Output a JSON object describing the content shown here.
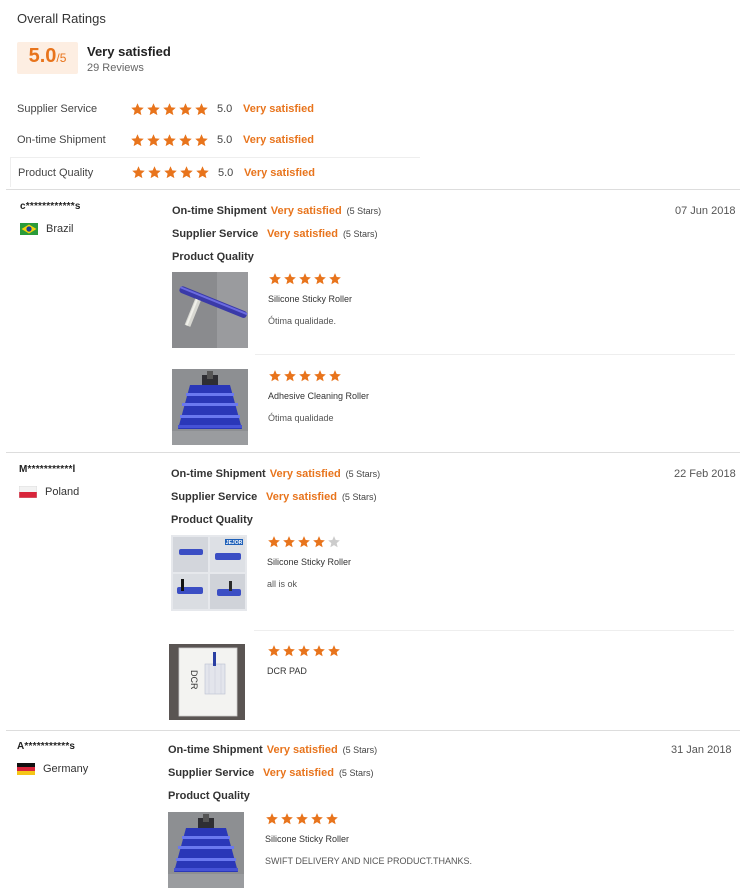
{
  "summary": {
    "title": "Overall Ratings",
    "score": "5.0",
    "score_den": "/5",
    "label": "Very satisfied",
    "count": "29 Reviews",
    "categories": [
      {
        "name": "Supplier Service",
        "score": "5.0",
        "word": "Very satisfied",
        "stars": 5
      },
      {
        "name": "On-time Shipment",
        "score": "5.0",
        "word": "Very satisfied",
        "stars": 5
      },
      {
        "name": "Product Quality",
        "score": "5.0",
        "word": "Very satisfied",
        "stars": 5
      }
    ]
  },
  "colors": {
    "accent": "#e8741c",
    "star_empty": "#cccccc",
    "score_bg": "#fdeee2"
  },
  "reviews": [
    {
      "name": "c************s",
      "country": "Brazil",
      "flag": "brazil-flag",
      "date": "07 Jun 2018",
      "shipment_label": "On-time Shipment",
      "shipment_value": "Very satisfied",
      "shipment_note": "(5 Stars)",
      "service_label": "Supplier Service",
      "service_value": "Very satisfied",
      "service_note": "(5 Stars)",
      "quality_label": "Product Quality",
      "products": [
        {
          "name": "Silicone Sticky Roller",
          "comment": "Ótima qualidade.",
          "stars": 5,
          "image": "roller-bar-photo"
        },
        {
          "name": "Adhesive Cleaning Roller",
          "comment": "Ótima qualidade",
          "stars": 5,
          "image": "blue-roller-photo"
        }
      ]
    },
    {
      "name": "M***********l",
      "country": "Poland",
      "flag": "poland-flag",
      "date": "22 Feb 2018",
      "shipment_label": "On-time Shipment",
      "shipment_value": "Very satisfied",
      "shipment_note": "(5 Stars)",
      "service_label": "Supplier Service",
      "service_value": "Very satisfied",
      "service_note": "(5 Stars)",
      "quality_label": "Product Quality",
      "products": [
        {
          "name": "Silicone Sticky Roller",
          "comment": "all is ok",
          "stars": 4,
          "image": "roller-catalog-photo",
          "image_text": "JEJOR"
        },
        {
          "name": "DCR PAD",
          "comment": "",
          "stars": 5,
          "image": "dcr-pad-photo",
          "image_text": "DCR"
        }
      ]
    },
    {
      "name": "A***********s",
      "country": "Germany",
      "flag": "germany-flag",
      "date": "31 Jan 2018",
      "shipment_label": "On-time Shipment",
      "shipment_value": "Very satisfied",
      "shipment_note": "(5 Stars)",
      "service_label": "Supplier Service",
      "service_value": "Very satisfied",
      "service_note": "(5 Stars)",
      "quality_label": "Product Quality",
      "products": [
        {
          "name": "Silicone Sticky Roller",
          "comment": "SWIFT DELIVERY AND NICE PRODUCT.THANKS.",
          "stars": 5,
          "image": "blue-roller-photo"
        }
      ]
    }
  ]
}
